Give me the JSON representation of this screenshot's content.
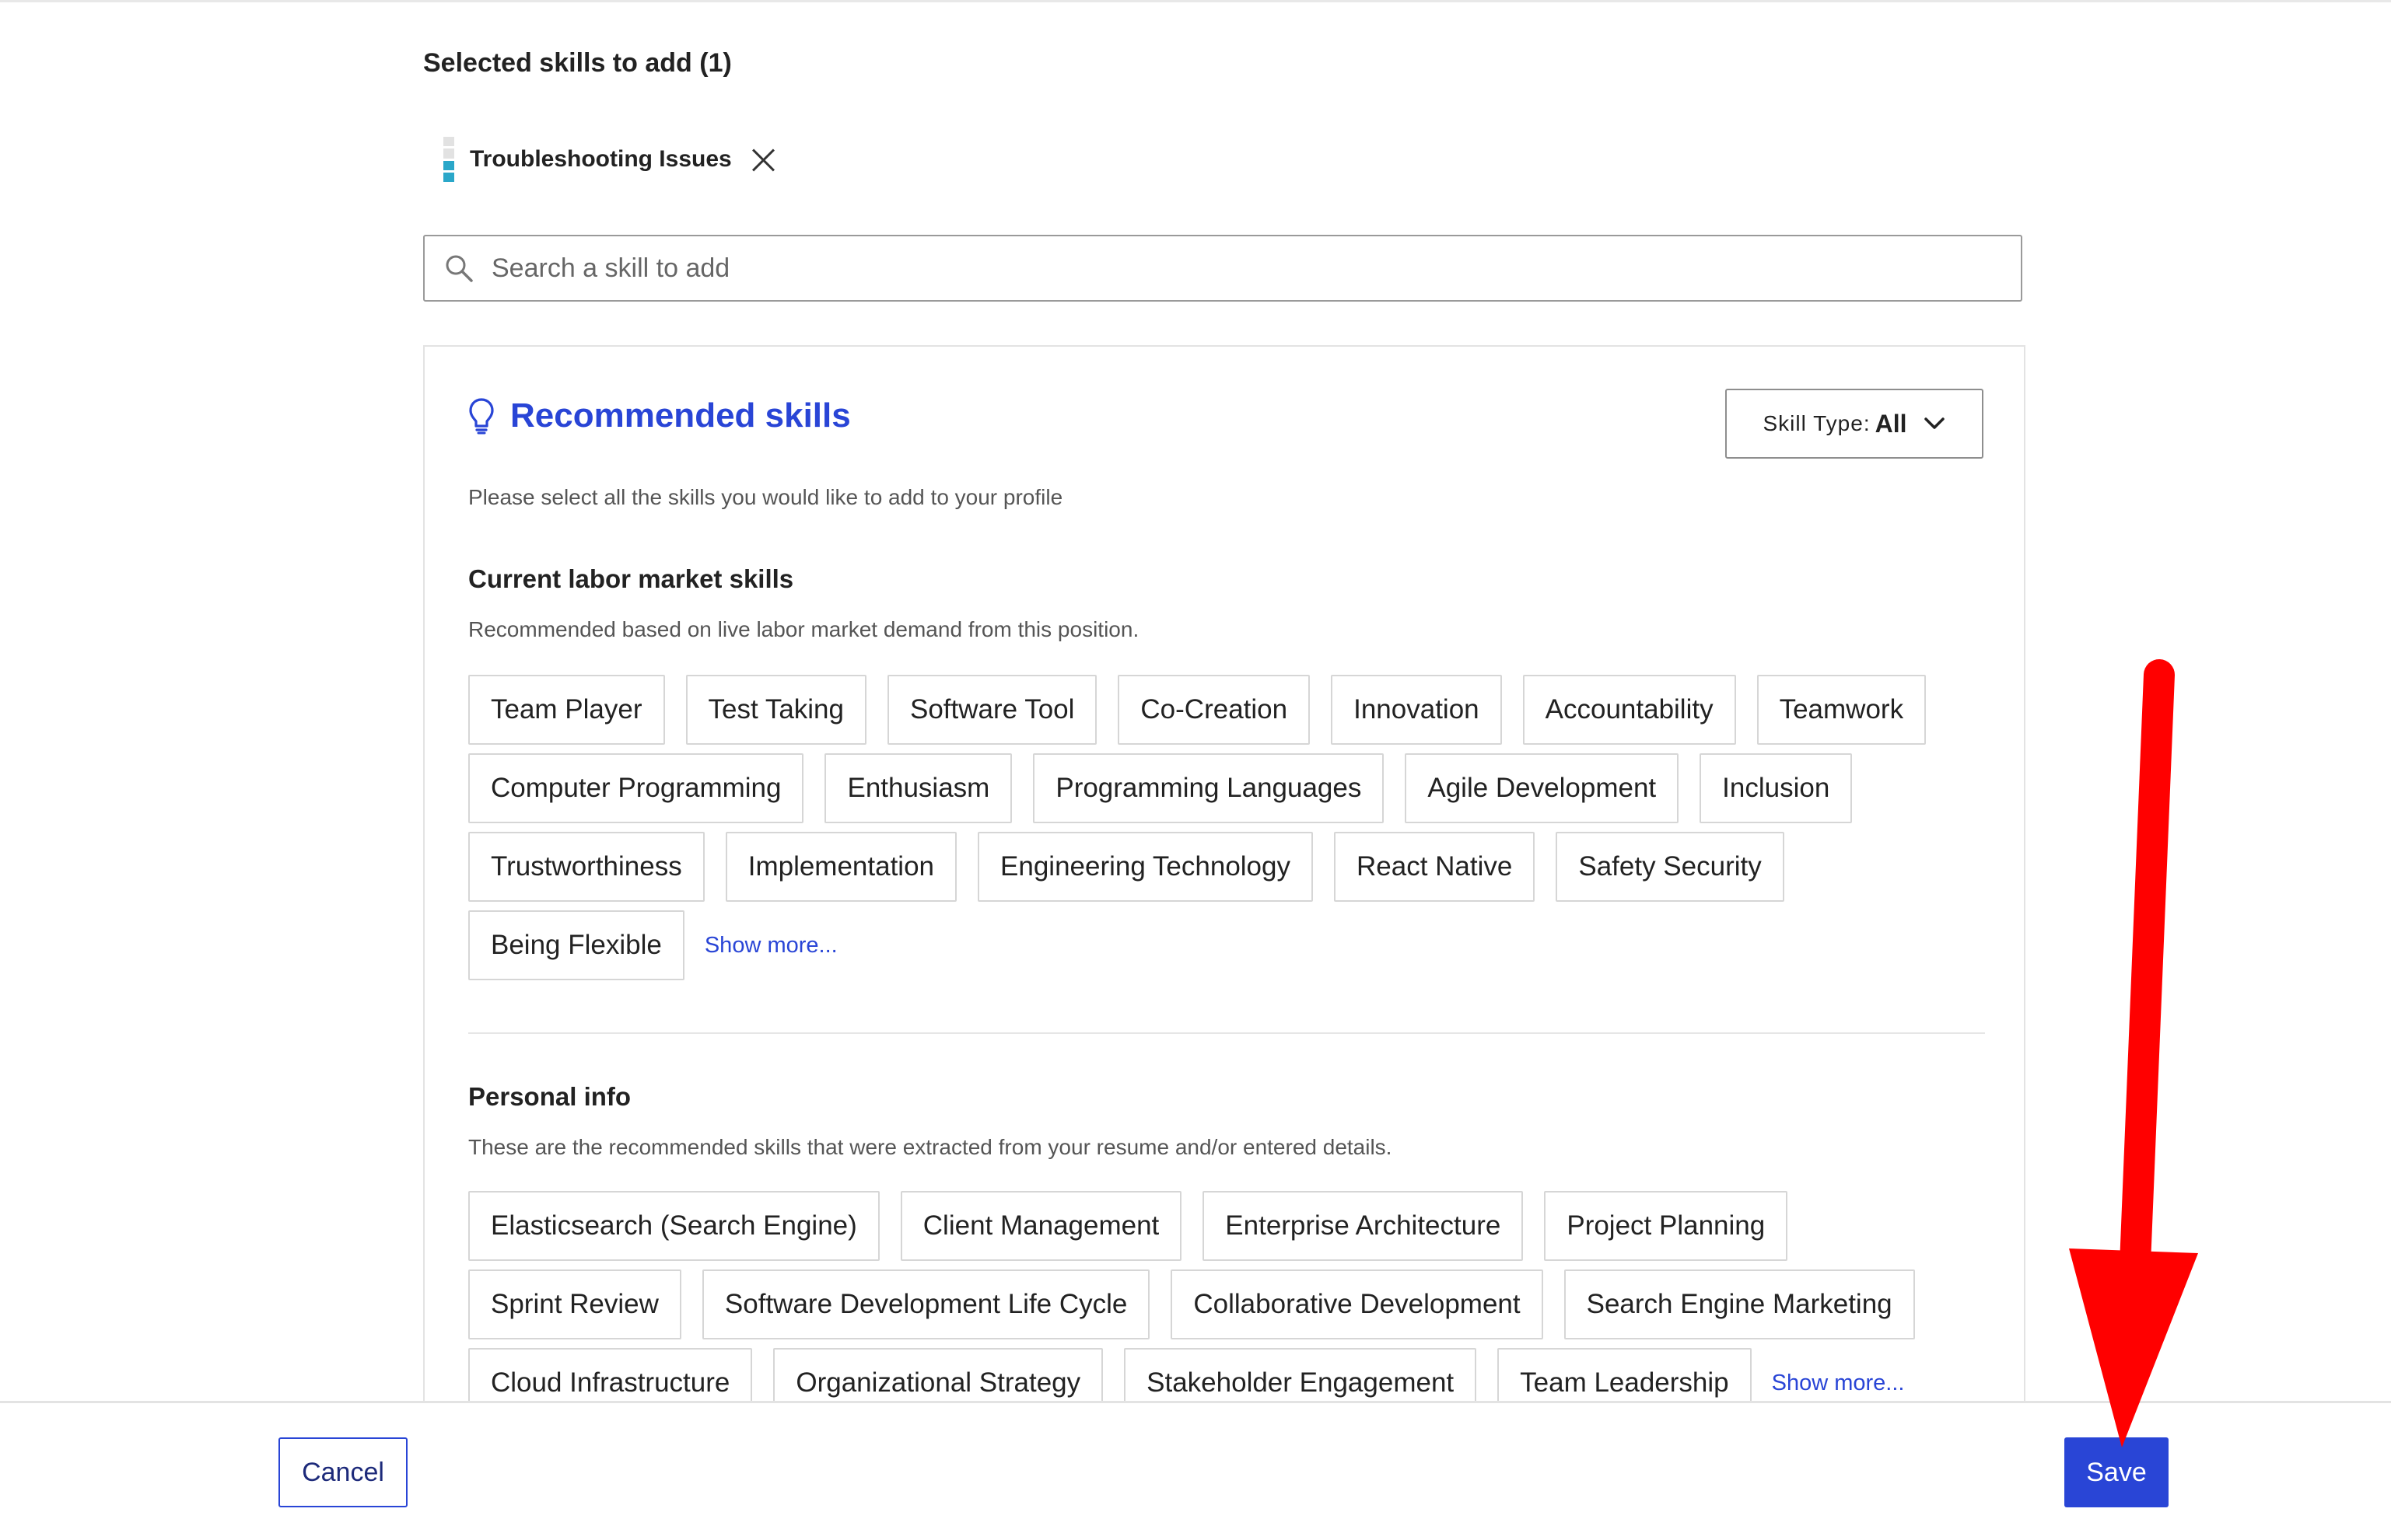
{
  "selected": {
    "title": "Selected skills to add (1)",
    "skills": [
      {
        "label": "Troubleshooting Issues",
        "level_icon": "level-bars-icon"
      }
    ]
  },
  "search": {
    "placeholder": "Search a skill to add",
    "value": ""
  },
  "recommended": {
    "title": "Recommended skills",
    "icon": "lightbulb-icon",
    "skill_type_label": "Skill Type:",
    "skill_type_value": "All",
    "description": "Please select all the skills you would like to add to your profile",
    "sections": [
      {
        "title": "Current labor market skills",
        "description": "Recommended based on live labor market demand from this position.",
        "skills": [
          "Team Player",
          "Test Taking",
          "Software Tool",
          "Co-Creation",
          "Innovation",
          "Accountability",
          "Teamwork",
          "Computer Programming",
          "Enthusiasm",
          "Programming Languages",
          "Agile Development",
          "Inclusion",
          "Trustworthiness",
          "Implementation",
          "Engineering Technology",
          "React Native",
          "Safety Security",
          "Being Flexible"
        ],
        "show_more": "Show more..."
      },
      {
        "title": "Personal info",
        "description": "These are the recommended skills that were extracted from your resume and/or entered details.",
        "skills": [
          "Elasticsearch (Search Engine)",
          "Client Management",
          "Enterprise Architecture",
          "Project Planning",
          "Sprint Review",
          "Software Development Life Cycle",
          "Collaborative Development",
          "Search Engine Marketing",
          "Cloud Infrastructure",
          "Organizational Strategy",
          "Stakeholder Engagement",
          "Team Leadership"
        ],
        "show_more": "Show more..."
      }
    ]
  },
  "footer": {
    "cancel": "Cancel",
    "save": "Save"
  },
  "colors": {
    "accent": "#2945d6",
    "annotation_arrow": "#ff0000",
    "level_fill": "#2aa7c9"
  }
}
